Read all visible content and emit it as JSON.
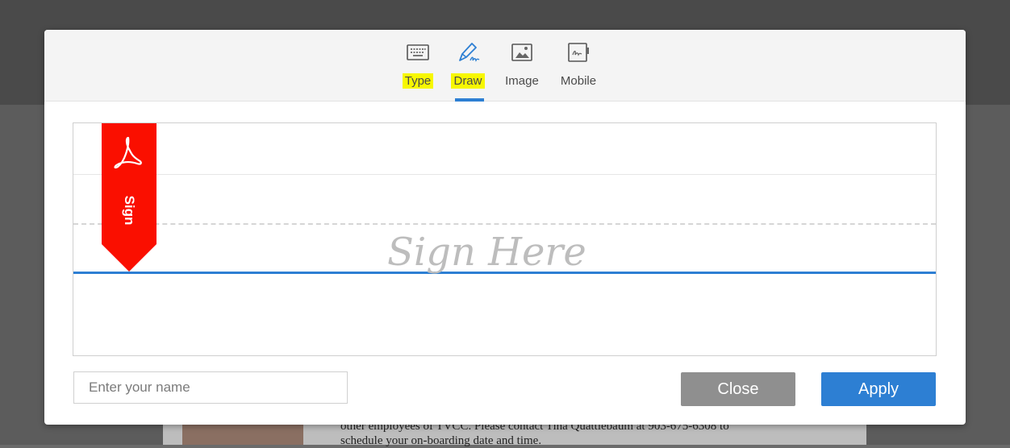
{
  "background_document": {
    "lines": [
      "other employees of TVCC. Please contact Tina Quattlebaum at 903-675-6308 to",
      "schedule your on-boarding date and time."
    ]
  },
  "signature_dialog": {
    "tabs": [
      {
        "label": "Type",
        "icon": "keyboard-icon",
        "highlighted": true,
        "active": false
      },
      {
        "label": "Draw",
        "icon": "pen-draw-icon",
        "highlighted": true,
        "active": true
      },
      {
        "label": "Image",
        "icon": "image-icon",
        "highlighted": false,
        "active": false
      },
      {
        "label": "Mobile",
        "icon": "mobile-signature-icon",
        "highlighted": false,
        "active": false
      }
    ],
    "canvas": {
      "placeholder": "Sign Here",
      "ribbon_label": "Sign",
      "ribbon_icon": "acrobat-logo-icon"
    },
    "name_input": {
      "value": "",
      "placeholder": "Enter your name"
    },
    "buttons": {
      "close_label": "Close",
      "apply_label": "Apply"
    },
    "colors": {
      "accent": "#2d7fd3",
      "ribbon": "#fa0f00",
      "highlight": "#f7f700",
      "close_button": "#8f8f8f"
    }
  }
}
